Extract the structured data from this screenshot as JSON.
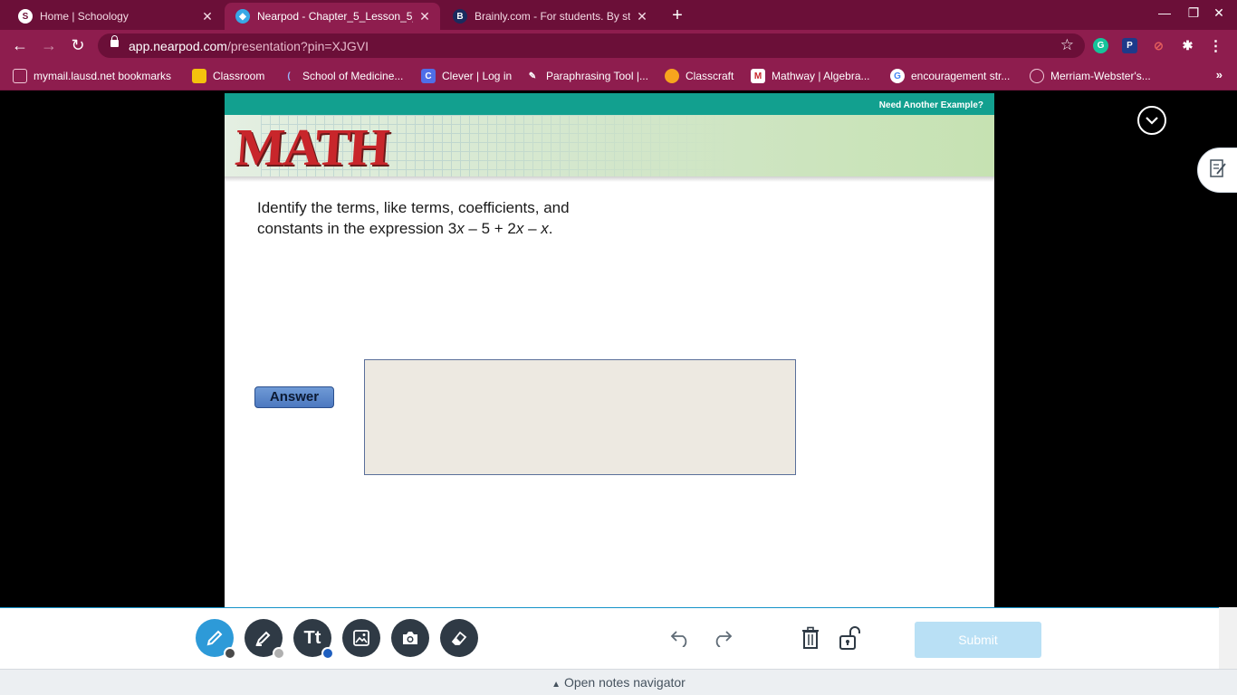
{
  "tabs": [
    {
      "title": "Home | Schoology",
      "favicon": "S",
      "active": false
    },
    {
      "title": "Nearpod - Chapter_5_Lesson_5_",
      "favicon": "N",
      "active": true
    },
    {
      "title": "Brainly.com - For students. By st",
      "favicon": "B",
      "active": false
    }
  ],
  "address": {
    "domain": "app.nearpod.com",
    "path": "/presentation?pin=XJGVI"
  },
  "bookmarks": [
    "mymail.lausd.net bookmarks",
    "Classroom",
    "School of Medicine...",
    "Clever | Log in",
    "Paraphrasing Tool |...",
    "Classcraft",
    "Mathway | Algebra...",
    "encouragement str...",
    "Merriam-Webster's..."
  ],
  "slide": {
    "need_example": "Need Another Example?",
    "logo_text": "MATH",
    "question_line1": "Identify the terms, like terms, coefficients, and",
    "question_line2_prefix": "constants in the expression 3",
    "answer_label": "Answer"
  },
  "toolbar": {
    "submit_label": "Submit",
    "text_tool_label": "Tt"
  },
  "notes_navigator": "Open notes navigator",
  "colors": {
    "chrome": "#8e1d4e",
    "tabstrip": "#6b0f38",
    "accent": "#2d9ad8",
    "banner_teal": "#12a08f"
  }
}
